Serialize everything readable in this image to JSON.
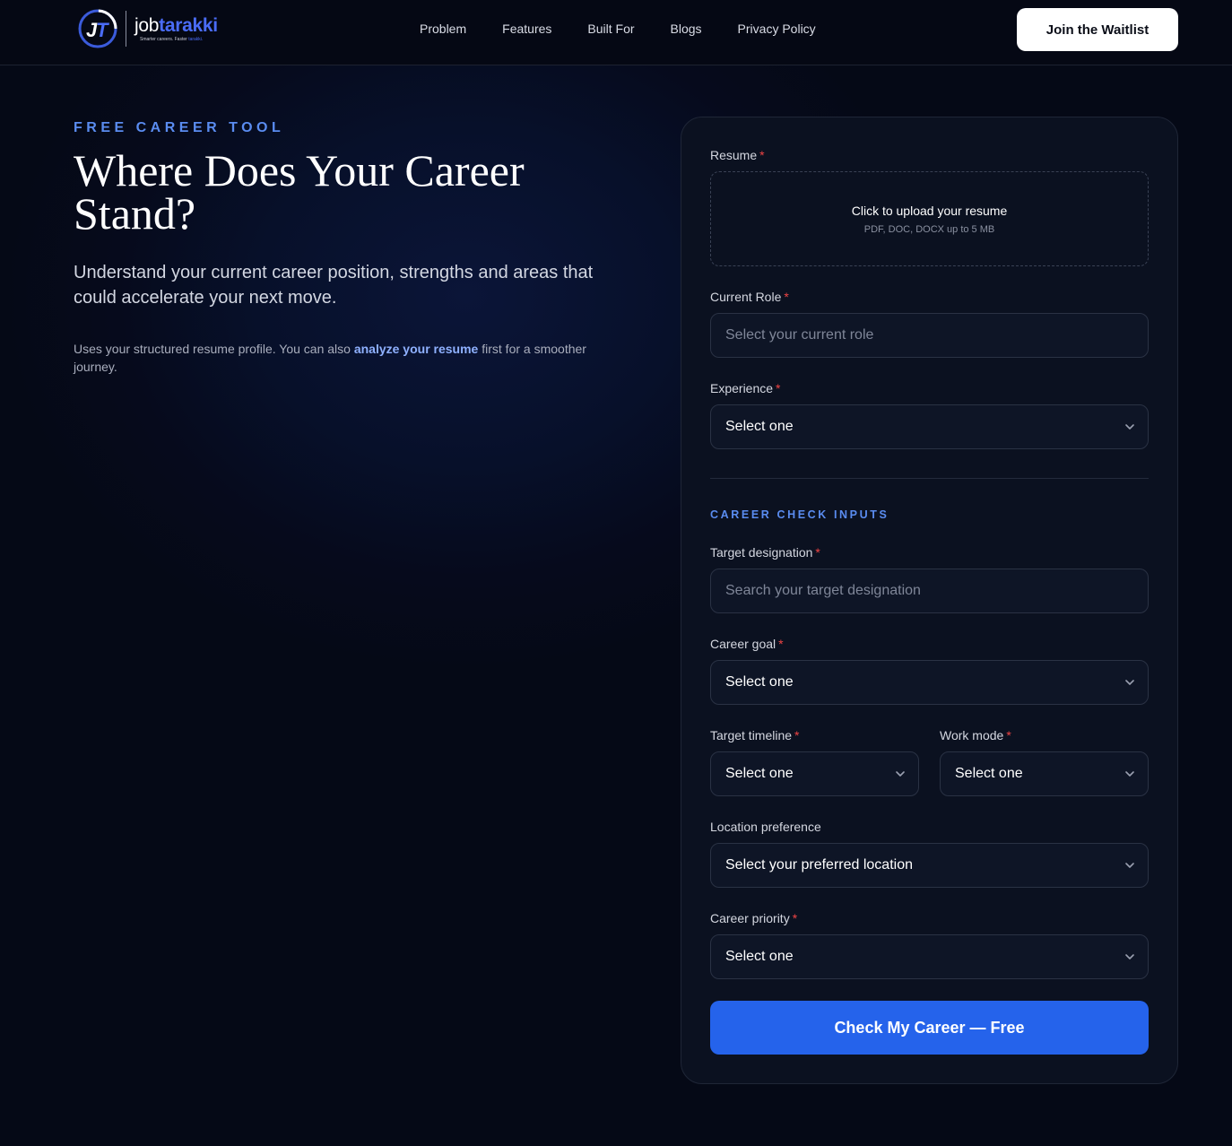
{
  "header": {
    "logo": {
      "word1": "job",
      "word2": "tarakki",
      "tagline": "Smarter careers. Faster ",
      "tagline_highlight": "tarakki."
    },
    "nav": [
      "Problem",
      "Features",
      "Built For",
      "Blogs",
      "Privacy Policy"
    ],
    "cta_label": "Join the Waitlist"
  },
  "hero": {
    "eyebrow": "FREE CAREER TOOL",
    "title": "Where Does Your Career Stand?",
    "subtitle": "Understand your current career position, strengths and areas that could accelerate your next move.",
    "note_before": "Uses your structured resume profile. You can also ",
    "note_link": "analyze your resume",
    "note_after": " first for a smoother journey."
  },
  "form": {
    "required_mark": "*",
    "resume": {
      "label": "Resume",
      "upload_title": "Click to upload your resume",
      "upload_hint": "PDF, DOC, DOCX up to 5 MB"
    },
    "current_role": {
      "label": "Current Role",
      "placeholder": "Select your current role"
    },
    "experience": {
      "label": "Experience",
      "value": "Select one"
    },
    "section_title": "CAREER CHECK INPUTS",
    "target_designation": {
      "label": "Target designation",
      "placeholder": "Search your target designation"
    },
    "career_goal": {
      "label": "Career goal",
      "value": "Select one"
    },
    "target_timeline": {
      "label": "Target timeline",
      "value": "Select one"
    },
    "work_mode": {
      "label": "Work mode",
      "value": "Select one"
    },
    "location_preference": {
      "label": "Location preference",
      "value": "Select your preferred location"
    },
    "career_priority": {
      "label": "Career priority",
      "value": "Select one"
    },
    "submit_label": "Check My Career — Free"
  },
  "colors": {
    "accent": "#2563eb",
    "eyebrow": "#5a8cf0",
    "link": "#8fb1ff",
    "required": "#ef4444",
    "background": "#060a1c"
  },
  "icons": [
    "jt-logo-icon",
    "chevron-down-icon"
  ]
}
